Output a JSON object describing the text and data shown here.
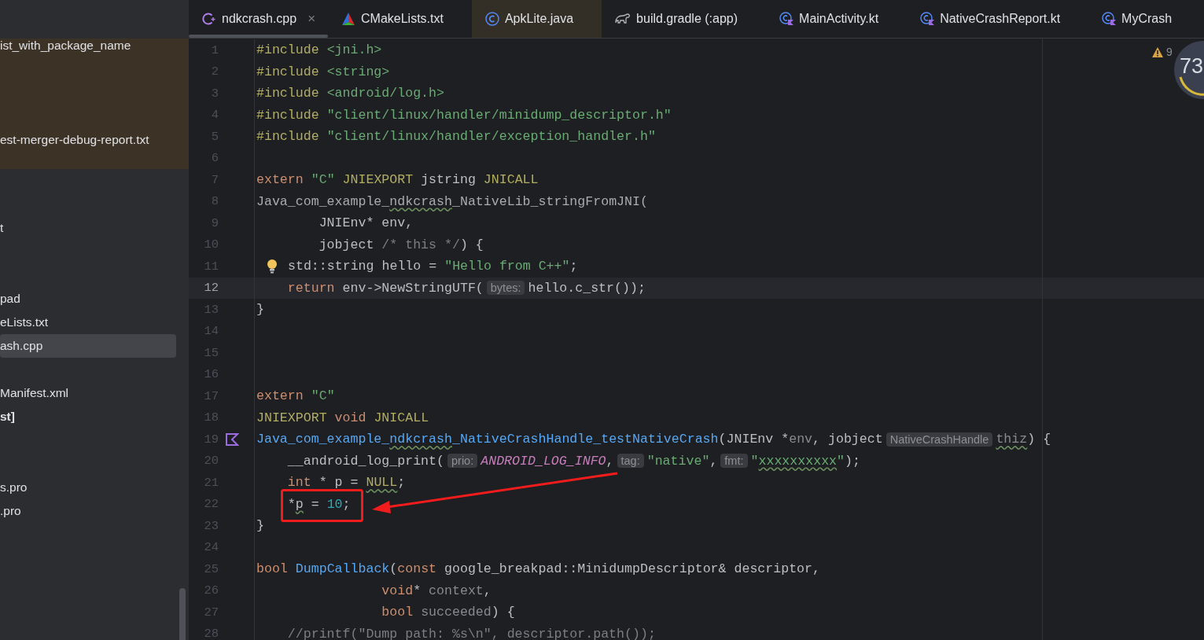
{
  "sidebar": {
    "items": [
      {
        "label": "ist_with_package_name",
        "highlighted": true,
        "selected": false,
        "bold": false
      },
      {
        "label": "est-merger-debug-report.txt",
        "highlighted": true,
        "selected": false,
        "bold": false
      },
      {
        "label": "t",
        "highlighted": false,
        "selected": false,
        "bold": false
      },
      {
        "label": "pad",
        "highlighted": false,
        "selected": false,
        "bold": false
      },
      {
        "label": "eLists.txt",
        "highlighted": false,
        "selected": false,
        "bold": false
      },
      {
        "label": "ash.cpp",
        "highlighted": false,
        "selected": true,
        "bold": false
      },
      {
        "label": "Manifest.xml",
        "highlighted": false,
        "selected": false,
        "bold": false
      },
      {
        "label": "st]",
        "highlighted": false,
        "selected": false,
        "bold": true
      },
      {
        "label": "s.pro",
        "highlighted": false,
        "selected": false,
        "bold": false
      },
      {
        "label": ".pro",
        "highlighted": false,
        "selected": false,
        "bold": false
      }
    ]
  },
  "tabs": [
    {
      "label": "ndkcrash.cpp",
      "kind": "cpp",
      "selected": true,
      "highlighted": false,
      "close": "×"
    },
    {
      "label": "CMakeLists.txt",
      "kind": "cmake",
      "selected": false,
      "highlighted": false
    },
    {
      "label": "ApkLite.java",
      "kind": "java",
      "selected": false,
      "highlighted": true
    },
    {
      "label": "build.gradle (:app)",
      "kind": "gradle",
      "selected": false,
      "highlighted": false
    },
    {
      "label": "MainActivity.kt",
      "kind": "kotlin",
      "selected": false,
      "highlighted": false
    },
    {
      "label": "NativeCrashReport.kt",
      "kind": "kotlin",
      "selected": false,
      "highlighted": false
    },
    {
      "label": "MyCrash",
      "kind": "kotlin",
      "selected": false,
      "highlighted": false
    }
  ],
  "editor": {
    "lines": [
      {
        "number": "1",
        "kind": "code",
        "current": false,
        "tokens": [
          {
            "kind": "dir",
            "text": "#include "
          },
          {
            "kind": "path",
            "text": "<jni.h>"
          }
        ]
      },
      {
        "number": "2",
        "kind": "code",
        "current": false,
        "tokens": [
          {
            "kind": "dir",
            "text": "#include "
          },
          {
            "kind": "path",
            "text": "<string>"
          }
        ]
      },
      {
        "number": "3",
        "kind": "code",
        "current": false,
        "tokens": [
          {
            "kind": "dir",
            "text": "#include "
          },
          {
            "kind": "path",
            "text": "<android/log.h>"
          }
        ]
      },
      {
        "number": "4",
        "kind": "code",
        "current": false,
        "tokens": [
          {
            "kind": "dir",
            "text": "#include "
          },
          {
            "kind": "path",
            "text": "\"client/linux/handler/minidump_descriptor.h\""
          }
        ]
      },
      {
        "number": "5",
        "kind": "code",
        "current": false,
        "tokens": [
          {
            "kind": "dir",
            "text": "#include "
          },
          {
            "kind": "path",
            "text": "\"client/linux/handler/exception_handler.h\""
          }
        ]
      },
      {
        "number": "6",
        "kind": "code",
        "current": false
      },
      {
        "number": "7",
        "kind": "code",
        "current": false,
        "tokens": [
          {
            "kind": "kw",
            "text": "extern "
          },
          {
            "kind": "str",
            "text": "\"C\" "
          },
          {
            "kind": "macro",
            "text": "JNIEXPORT"
          },
          {
            "kind": "plain",
            "text": " jstring "
          },
          {
            "kind": "macro",
            "text": "JNICALL"
          }
        ]
      },
      {
        "number": "8",
        "kind": "code",
        "current": false,
        "tokens": [
          {
            "kind": "dim",
            "text": "Java_com_example_"
          },
          {
            "kind": "dim",
            "text": "ndkcrash",
            "warning": true
          },
          {
            "kind": "dim",
            "text": "_NativeLib_stringFromJNI("
          }
        ]
      },
      {
        "number": "9",
        "kind": "code",
        "current": false,
        "tokens": [
          {
            "kind": "plain",
            "text": "        JNIEnv* env,"
          }
        ]
      },
      {
        "number": "10",
        "kind": "code",
        "current": false,
        "tokens": [
          {
            "kind": "plain",
            "text": "        jobject "
          },
          {
            "kind": "comment",
            "text": "/* this */"
          },
          {
            "kind": "plain",
            "text": ") {"
          }
        ]
      },
      {
        "number": "11",
        "kind": "bulb",
        "current": false,
        "tokens": [
          {
            "kind": "plain",
            "text": "std::string hello = "
          },
          {
            "kind": "str",
            "text": "\"Hello from C++\""
          },
          {
            "kind": "plain",
            "text": ";"
          }
        ]
      },
      {
        "number": "12",
        "kind": "code",
        "current": true,
        "tokens": [
          {
            "kind": "kw",
            "text": "    return"
          },
          {
            "kind": "plain",
            "text": " env->NewStringUTF("
          },
          {
            "kind": "hint",
            "text": "bytes:"
          },
          {
            "kind": "plain",
            "text": "hello.c_str());"
          }
        ]
      },
      {
        "number": "13",
        "kind": "code",
        "current": false,
        "tokens": [
          {
            "kind": "plain",
            "text": "}"
          }
        ]
      },
      {
        "number": "14",
        "kind": "code",
        "current": false
      },
      {
        "number": "15",
        "kind": "code",
        "current": false
      },
      {
        "number": "16",
        "kind": "code",
        "current": false
      },
      {
        "number": "17",
        "kind": "code",
        "current": false,
        "tokens": [
          {
            "kind": "kw",
            "text": "extern "
          },
          {
            "kind": "str",
            "text": "\"C\""
          }
        ]
      },
      {
        "number": "18",
        "kind": "code",
        "current": false,
        "tokens": [
          {
            "kind": "macro",
            "text": "JNIEXPORT "
          },
          {
            "kind": "kw",
            "text": "void "
          },
          {
            "kind": "macro",
            "text": "JNICALL"
          }
        ]
      },
      {
        "number": "19",
        "kind": "implemented",
        "current": false,
        "tokens": [
          {
            "kind": "fn",
            "text": "Java_com_example_"
          },
          {
            "kind": "fn",
            "text": "ndkcrash",
            "warning": true
          },
          {
            "kind": "fn",
            "text": "_NativeCrashHandle_testNativeCrash"
          },
          {
            "kind": "plain",
            "text": "(JNIEnv *"
          },
          {
            "kind": "param",
            "text": "env"
          },
          {
            "kind": "plain",
            "text": ", jobject"
          },
          {
            "kind": "hint",
            "text": "NativeCrashHandle"
          },
          {
            "kind": "param",
            "text": "thiz",
            "warning": true
          },
          {
            "kind": "plain",
            "text": ") {"
          }
        ]
      },
      {
        "number": "20",
        "kind": "code",
        "current": false,
        "tokens": [
          {
            "kind": "plain",
            "text": "    __android_log_print("
          },
          {
            "kind": "hint",
            "text": "prio:"
          },
          {
            "kind": "enum",
            "text": "ANDROID_LOG_INFO"
          },
          {
            "kind": "plain",
            "text": ","
          },
          {
            "kind": "hint",
            "text": "tag:"
          },
          {
            "kind": "str",
            "text": "\"native\""
          },
          {
            "kind": "plain",
            "text": ","
          },
          {
            "kind": "hint",
            "text": "fmt:"
          },
          {
            "kind": "str",
            "text": "\""
          },
          {
            "kind": "str",
            "text": "xxxxxxxxxx",
            "warning": true
          },
          {
            "kind": "str",
            "text": "\""
          },
          {
            "kind": "plain",
            "text": ");"
          }
        ]
      },
      {
        "number": "21",
        "kind": "code",
        "current": false,
        "tokens": [
          {
            "kind": "kw",
            "text": "    int"
          },
          {
            "kind": "plain",
            "text": " * p = "
          },
          {
            "kind": "macro",
            "text": "NULL",
            "warning": true
          },
          {
            "kind": "plain",
            "text": ";"
          }
        ]
      },
      {
        "number": "22",
        "kind": "code",
        "current": false,
        "tokens": [
          {
            "kind": "plain",
            "text": "    *"
          },
          {
            "kind": "plain",
            "text": "p",
            "warning": true
          },
          {
            "kind": "plain",
            "text": " = "
          },
          {
            "kind": "num",
            "text": "10"
          },
          {
            "kind": "plain",
            "text": ";"
          }
        ]
      },
      {
        "number": "23",
        "kind": "code",
        "current": false,
        "tokens": [
          {
            "kind": "plain",
            "text": "}"
          }
        ]
      },
      {
        "number": "24",
        "kind": "code",
        "current": false
      },
      {
        "number": "25",
        "kind": "code",
        "current": false,
        "tokens": [
          {
            "kind": "kw",
            "text": "bool "
          },
          {
            "kind": "fn",
            "text": "DumpCallback"
          },
          {
            "kind": "plain",
            "text": "("
          },
          {
            "kind": "kw",
            "text": "const"
          },
          {
            "kind": "plain",
            "text": " google_breakpad::MinidumpDescriptor& descriptor,"
          }
        ]
      },
      {
        "number": "26",
        "kind": "code",
        "current": false,
        "tokens": [
          {
            "kind": "kw",
            "text": "                void"
          },
          {
            "kind": "plain",
            "text": "* "
          },
          {
            "kind": "param",
            "text": "context"
          },
          {
            "kind": "plain",
            "text": ","
          }
        ]
      },
      {
        "number": "27",
        "kind": "code",
        "current": false,
        "tokens": [
          {
            "kind": "kw",
            "text": "                bool "
          },
          {
            "kind": "param",
            "text": "succeeded"
          },
          {
            "kind": "plain",
            "text": ") {"
          }
        ]
      },
      {
        "number": "28",
        "kind": "code",
        "current": false,
        "tokens": [
          {
            "kind": "comment",
            "text": "    //printf(\"Dump path: %s\\n\", descriptor.path());"
          }
        ]
      }
    ]
  },
  "inspection_widget": {
    "warnings": "9",
    "score": "73"
  }
}
